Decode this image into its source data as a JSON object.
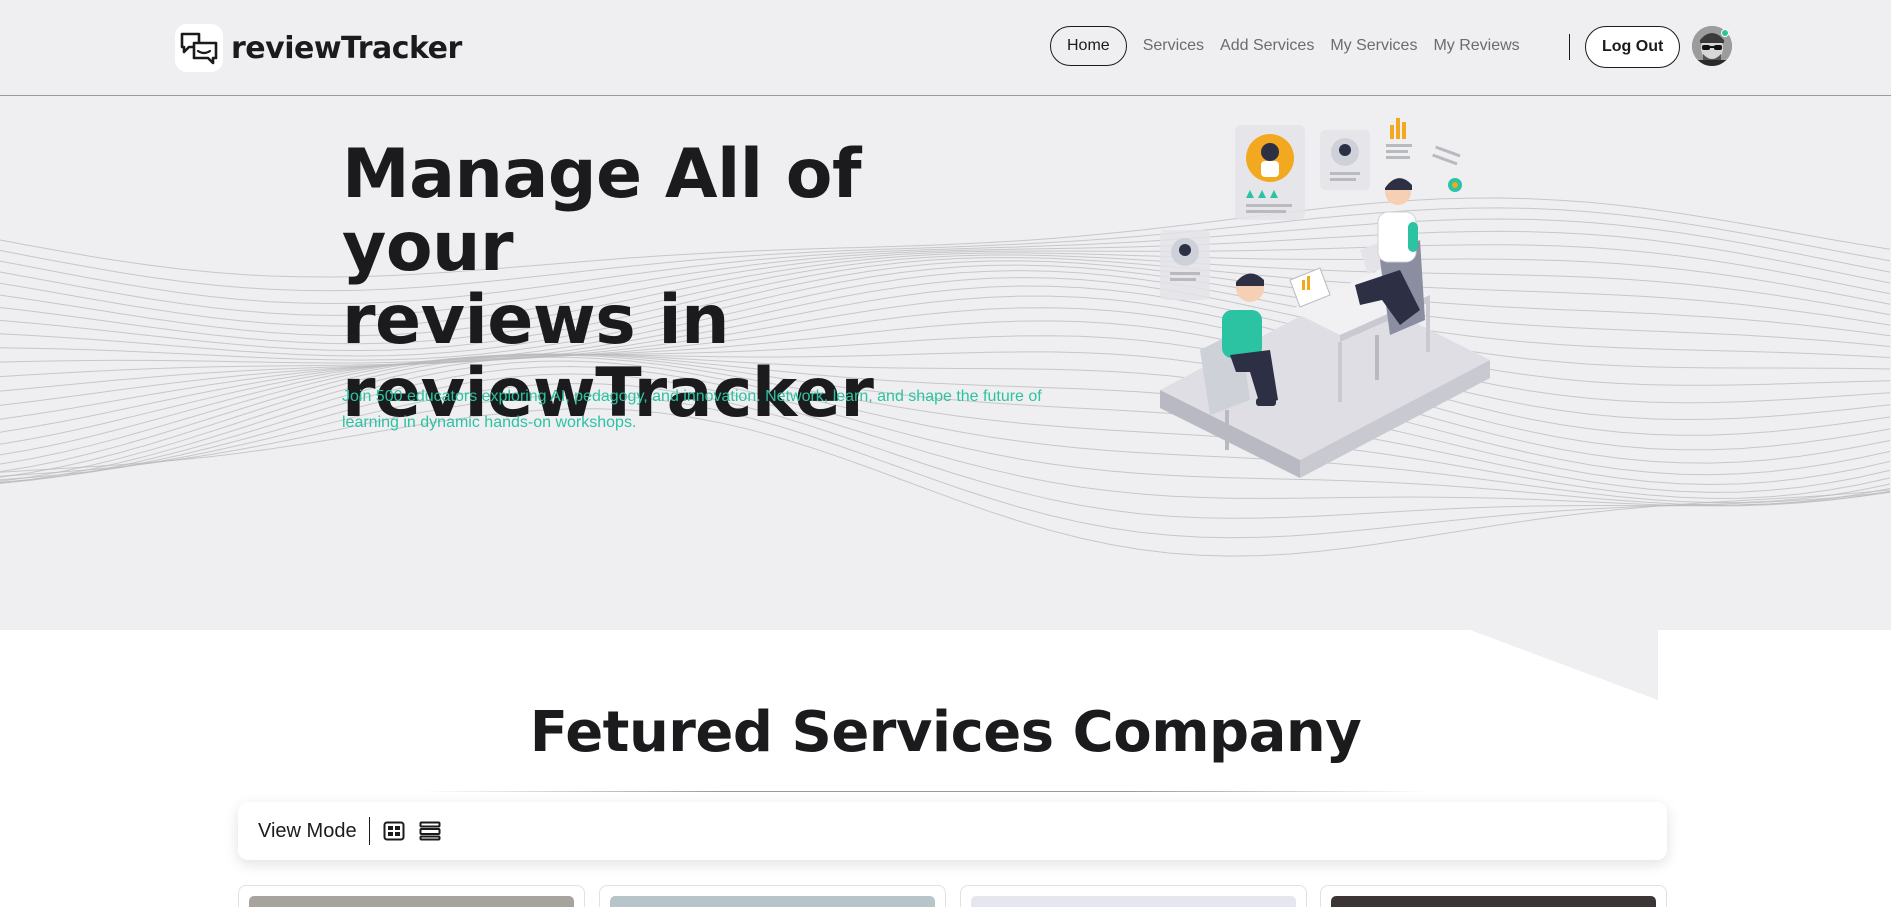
{
  "brand": {
    "name": "reviewTracker"
  },
  "nav": {
    "links": [
      {
        "label": "Home",
        "active": true
      },
      {
        "label": "Services",
        "active": false
      },
      {
        "label": "Add Services",
        "active": false
      },
      {
        "label": "My Services",
        "active": false
      },
      {
        "label": "My Reviews",
        "active": false
      }
    ],
    "logout_label": "Log Out"
  },
  "hero": {
    "title_lines": [
      "Manage All of your",
      "reviews in",
      "reviewTracker"
    ],
    "subtitle_line1": "Join 500 educators exploring AI, pedagogy, and innovation. Network, learn, and shape the future of",
    "subtitle_line2": "learning in dynamic hands-on workshops."
  },
  "section": {
    "title": "Fetured Services Company",
    "view_mode_label": "View Mode",
    "view_icons": [
      "grid-view-icon",
      "list-view-icon"
    ]
  },
  "cards": [
    {
      "tone": "#a7a39d"
    },
    {
      "tone": "#b7c4c9"
    },
    {
      "tone": "#e6e6ef"
    },
    {
      "tone": "#3b3536"
    }
  ],
  "colors": {
    "hero_bg": "#efeff1",
    "accent_teal": "#2cc3a2",
    "accent_orange": "#f2a91f",
    "text_dark": "#1b1b1d",
    "online_status": "#27c88f"
  }
}
